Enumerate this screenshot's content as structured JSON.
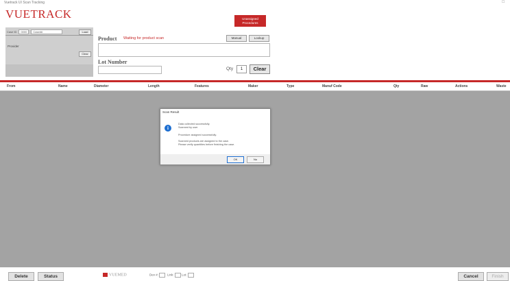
{
  "window": {
    "title": "Vuetrack UI Scan Tracking",
    "controls": "□"
  },
  "app": {
    "logo": "VUETRACK",
    "top_button": "Unassigned Procedures"
  },
  "left_panel": {
    "case_label": "Case ID",
    "case_value": "0000",
    "search_value": "Case##",
    "load_label": "Load",
    "provider_label": "Provider",
    "clear_label": "Clear"
  },
  "product": {
    "label": "Product",
    "status": "Waiting for product scan",
    "manual_button": "Manual",
    "lookup_button": "Lookup"
  },
  "lot": {
    "label": "Lot Number"
  },
  "qty": {
    "label": "Qty",
    "value": "1"
  },
  "clear_button": "Clear",
  "grid": {
    "columns": [
      "From",
      "Name",
      "Diameter",
      "Length",
      "Features",
      "Maker",
      "Type",
      "Manuf Code",
      "Qty",
      "Raw",
      "Actions",
      "Waste"
    ]
  },
  "dialog": {
    "title": "Scan Result",
    "message1": "Data collected successfully.",
    "message2": "Scanned by user",
    "message3": "Procedure assigned successfully.",
    "message4": "Scanned products are assigned to the case.",
    "message5": "Please verify quantities before finishing the case.",
    "ok": "OK",
    "no": "No"
  },
  "bottom": {
    "delete": "Delete",
    "status": "Status",
    "brand": "VUEMED",
    "field1_label": "Dev #:",
    "field2_label": "Link:",
    "field3_label": "Lot:",
    "cancel": "Cancel",
    "finish": "Finish"
  }
}
